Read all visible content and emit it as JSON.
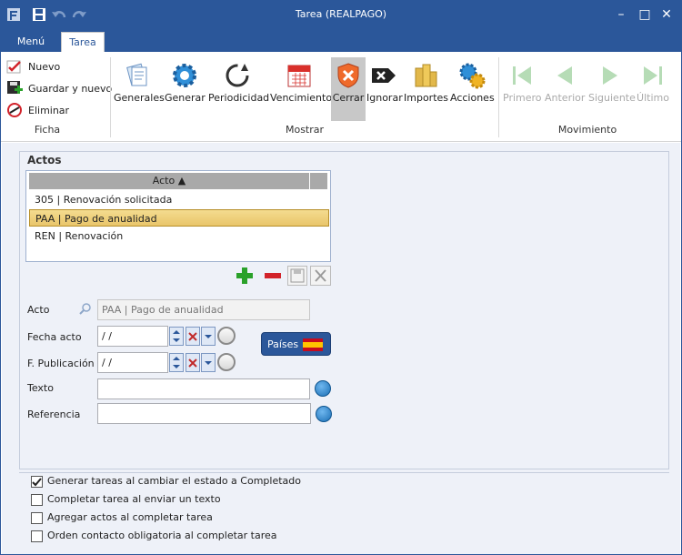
{
  "window": {
    "title": "Tarea (REALPAGO)",
    "min": "–",
    "max": "□",
    "close": "✕"
  },
  "menu": {
    "tabs": [
      {
        "label": "Menú"
      },
      {
        "label": "Tarea"
      }
    ]
  },
  "ribbon": {
    "ficha": {
      "label": "Ficha",
      "items": [
        {
          "label": "Nuevo"
        },
        {
          "label": "Guardar y nuevo"
        },
        {
          "label": "Eliminar"
        }
      ]
    },
    "mostrar": {
      "label": "Mostrar",
      "items": [
        {
          "label": "Generales"
        },
        {
          "label": "Generar"
        },
        {
          "label": "Periodicidad"
        },
        {
          "label": "Vencimiento"
        },
        {
          "label": "Cerrar"
        },
        {
          "label": "Ignorar"
        },
        {
          "label": "Importes"
        },
        {
          "label": "Acciones"
        }
      ]
    },
    "movimiento": {
      "label": "Movimiento",
      "items": [
        {
          "label": "Primero"
        },
        {
          "label": "Anterior"
        },
        {
          "label": "Siguiente"
        },
        {
          "label": "Último"
        }
      ]
    }
  },
  "actos": {
    "title": "Actos",
    "column": "Acto",
    "rows": [
      {
        "text": "305 | Renovación solicitada"
      },
      {
        "text": "PAA | Pago de anualidad"
      },
      {
        "text": "REN | Renovación"
      }
    ]
  },
  "form": {
    "acto_label": "Acto",
    "acto_value": "PAA | Pago de anualidad",
    "fecha_label": "Fecha acto",
    "fecha_value": " /  /",
    "fpub_label": "F. Publicación",
    "fpub_value": " /  /",
    "texto_label": "Texto",
    "texto_value": "",
    "ref_label": "Referencia",
    "ref_value": "",
    "paises": "Países"
  },
  "options": [
    {
      "label": "Generar tareas al cambiar el estado a Completado",
      "checked": true
    },
    {
      "label": "Completar tarea al enviar un texto",
      "checked": false
    },
    {
      "label": "Agregar actos al completar tarea",
      "checked": false
    },
    {
      "label": "Orden contacto obligatoria al completar tarea",
      "checked": false
    }
  ]
}
